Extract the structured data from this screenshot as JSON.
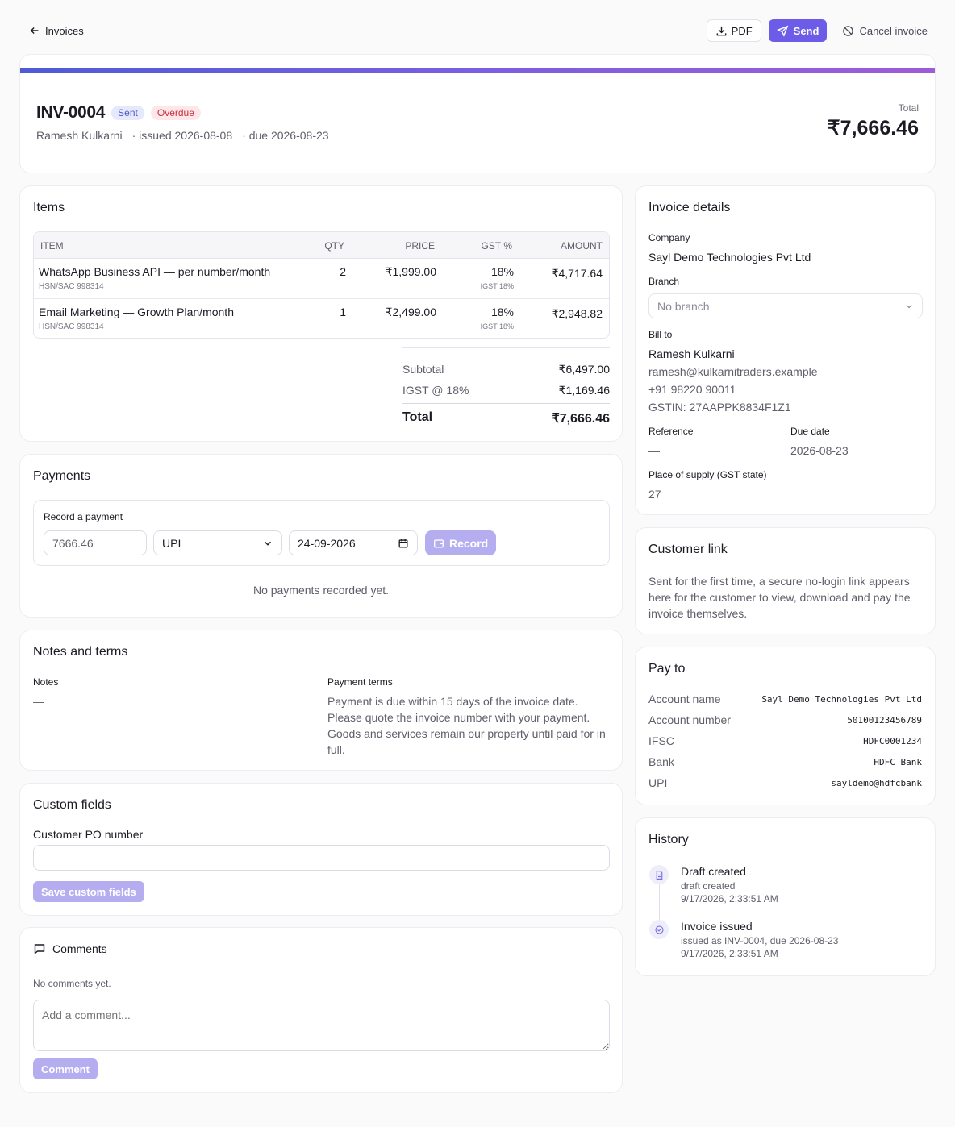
{
  "topbar": {
    "back_label": "Invoices",
    "pdf_label": "PDF",
    "send_label": "Send",
    "cancel_label": "Cancel invoice"
  },
  "invoice": {
    "number": "INV-0004",
    "status_sent": "Sent",
    "status_overdue": "Overdue",
    "customer": "Ramesh Kulkarni",
    "issued": "· issued 2026-08-08",
    "due": "· due 2026-08-23",
    "total_label": "Total",
    "total": "₹7,666.46"
  },
  "items": {
    "title": "Items",
    "columns": {
      "item": "ITEM",
      "qty": "QTY",
      "price": "PRICE",
      "gst": "GST %",
      "amount": "AMOUNT"
    },
    "rows": [
      {
        "name": "WhatsApp Business API — per number/month",
        "hsn": "HSN/SAC 998314",
        "qty": "2",
        "price": "₹1,999.00",
        "gst": "18%",
        "gst_sub": "IGST 18%",
        "amount": "₹4,717.64"
      },
      {
        "name": "Email Marketing — Growth Plan/month",
        "hsn": "HSN/SAC 998314",
        "qty": "1",
        "price": "₹2,499.00",
        "gst": "18%",
        "gst_sub": "IGST 18%",
        "amount": "₹2,948.82"
      }
    ],
    "subtotal_label": "Subtotal",
    "subtotal": "₹6,497.00",
    "tax_label": "IGST @ 18%",
    "tax": "₹1,169.46",
    "total_label": "Total",
    "total": "₹7,666.46"
  },
  "payments": {
    "title": "Payments",
    "record_label": "Record a payment",
    "amount_value": "7666.46",
    "method_value": "UPI",
    "date_value": "24-09-2026",
    "record_button": "Record",
    "empty_text": "No payments recorded yet."
  },
  "notes": {
    "title": "Notes and terms",
    "notes_label": "Notes",
    "notes_value": "—",
    "terms_label": "Payment terms",
    "terms_value": "Payment is due within 15 days of the invoice date. Please quote the invoice number with your payment. Goods and services remain our property until paid for in full."
  },
  "custom_fields": {
    "title": "Custom fields",
    "po_label": "Customer PO number",
    "po_value": "",
    "save_button": "Save custom fields"
  },
  "comments": {
    "title": "Comments",
    "empty_text": "No comments yet.",
    "placeholder": "Add a comment...",
    "button": "Comment"
  },
  "details": {
    "title": "Invoice details",
    "company_label": "Company",
    "company": "Sayl Demo Technologies Pvt Ltd",
    "branch_label": "Branch",
    "branch_value": "No branch",
    "bill_to_label": "Bill to",
    "bill_name": "Ramesh Kulkarni",
    "bill_email": "ramesh@kulkarnitraders.example",
    "bill_phone": "+91 98220 90011",
    "bill_gstin": "GSTIN: 27AAPPK8834F1Z1",
    "reference_label": "Reference",
    "reference": "—",
    "due_label": "Due date",
    "due": "2026-08-23",
    "supply_label": "Place of supply (GST state)",
    "supply": "27"
  },
  "customer_link": {
    "title": "Customer link",
    "text": "Sent for the first time, a secure no-login link appears here for the customer to view, download and pay the invoice themselves."
  },
  "pay_to": {
    "title": "Pay to",
    "rows": [
      {
        "key": "Account name",
        "value": "Sayl Demo Technologies Pvt Ltd"
      },
      {
        "key": "Account number",
        "value": "50100123456789"
      },
      {
        "key": "IFSC",
        "value": "HDFC0001234"
      },
      {
        "key": "Bank",
        "value": "HDFC Bank"
      },
      {
        "key": "UPI",
        "value": "sayldemo@hdfcbank"
      }
    ]
  },
  "history": {
    "title": "History",
    "events": [
      {
        "title": "Draft created",
        "detail": "draft created",
        "time": "9/17/2026, 2:33:51 AM"
      },
      {
        "title": "Invoice issued",
        "detail": "issued as INV-0004, due 2026-08-23",
        "time": "9/17/2026, 2:33:51 AM"
      }
    ]
  },
  "colors": {
    "accent": "#6c5ce7",
    "accent_soft": "#b4aef0",
    "overdue": "#c8303d",
    "sent": "#5058c9"
  }
}
